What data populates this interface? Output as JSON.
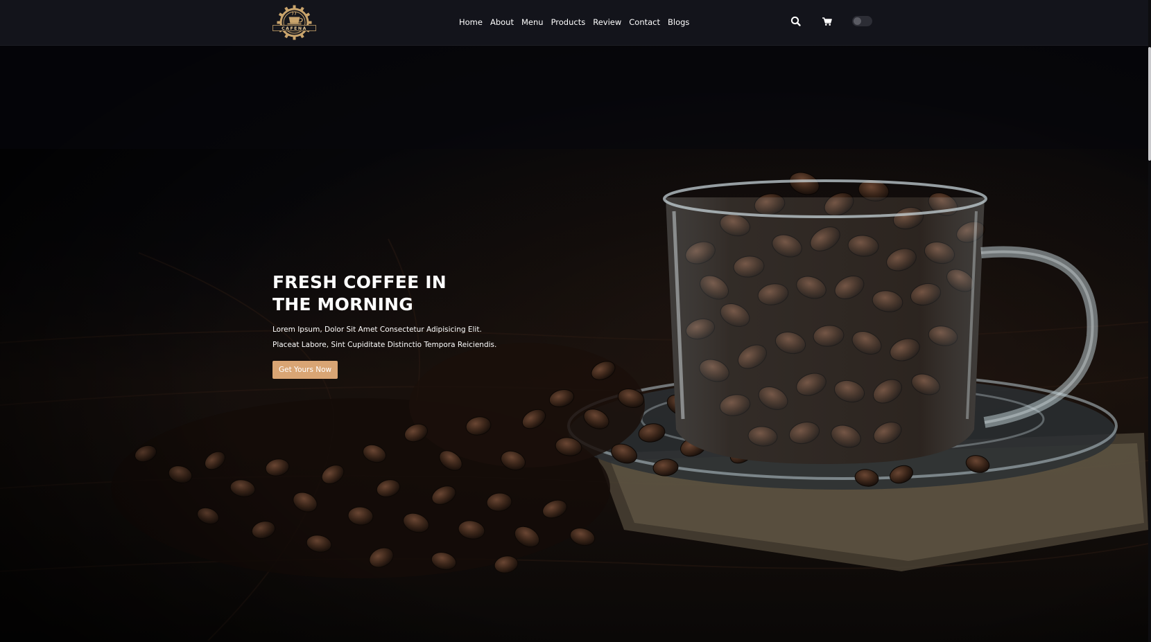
{
  "brand": {
    "logo_text": "CAFENA"
  },
  "nav": {
    "items": [
      "Home",
      "About",
      "Menu",
      "Products",
      "Review",
      "Contact",
      "Blogs"
    ]
  },
  "header_icons": {
    "search": "search-icon",
    "cart": "cart-icon",
    "theme_toggle": "dark-mode-toggle"
  },
  "hero": {
    "title_line1": "FRESH COFFEE IN",
    "title_line2": "THE MORNING",
    "description": "Lorem Ipsum, Dolor Sit Amet Consectetur Adipisicing Elit. Placeat Labore, Sint Cupiditate Distinctio Tempora Reiciendis.",
    "cta_label": "Get Yours Now",
    "image": "glass-cup-of-coffee-beans-on-saucer"
  },
  "colors": {
    "header_bg": "#13141b",
    "accent": "#d9a574",
    "hero_bg": "#06070b"
  }
}
